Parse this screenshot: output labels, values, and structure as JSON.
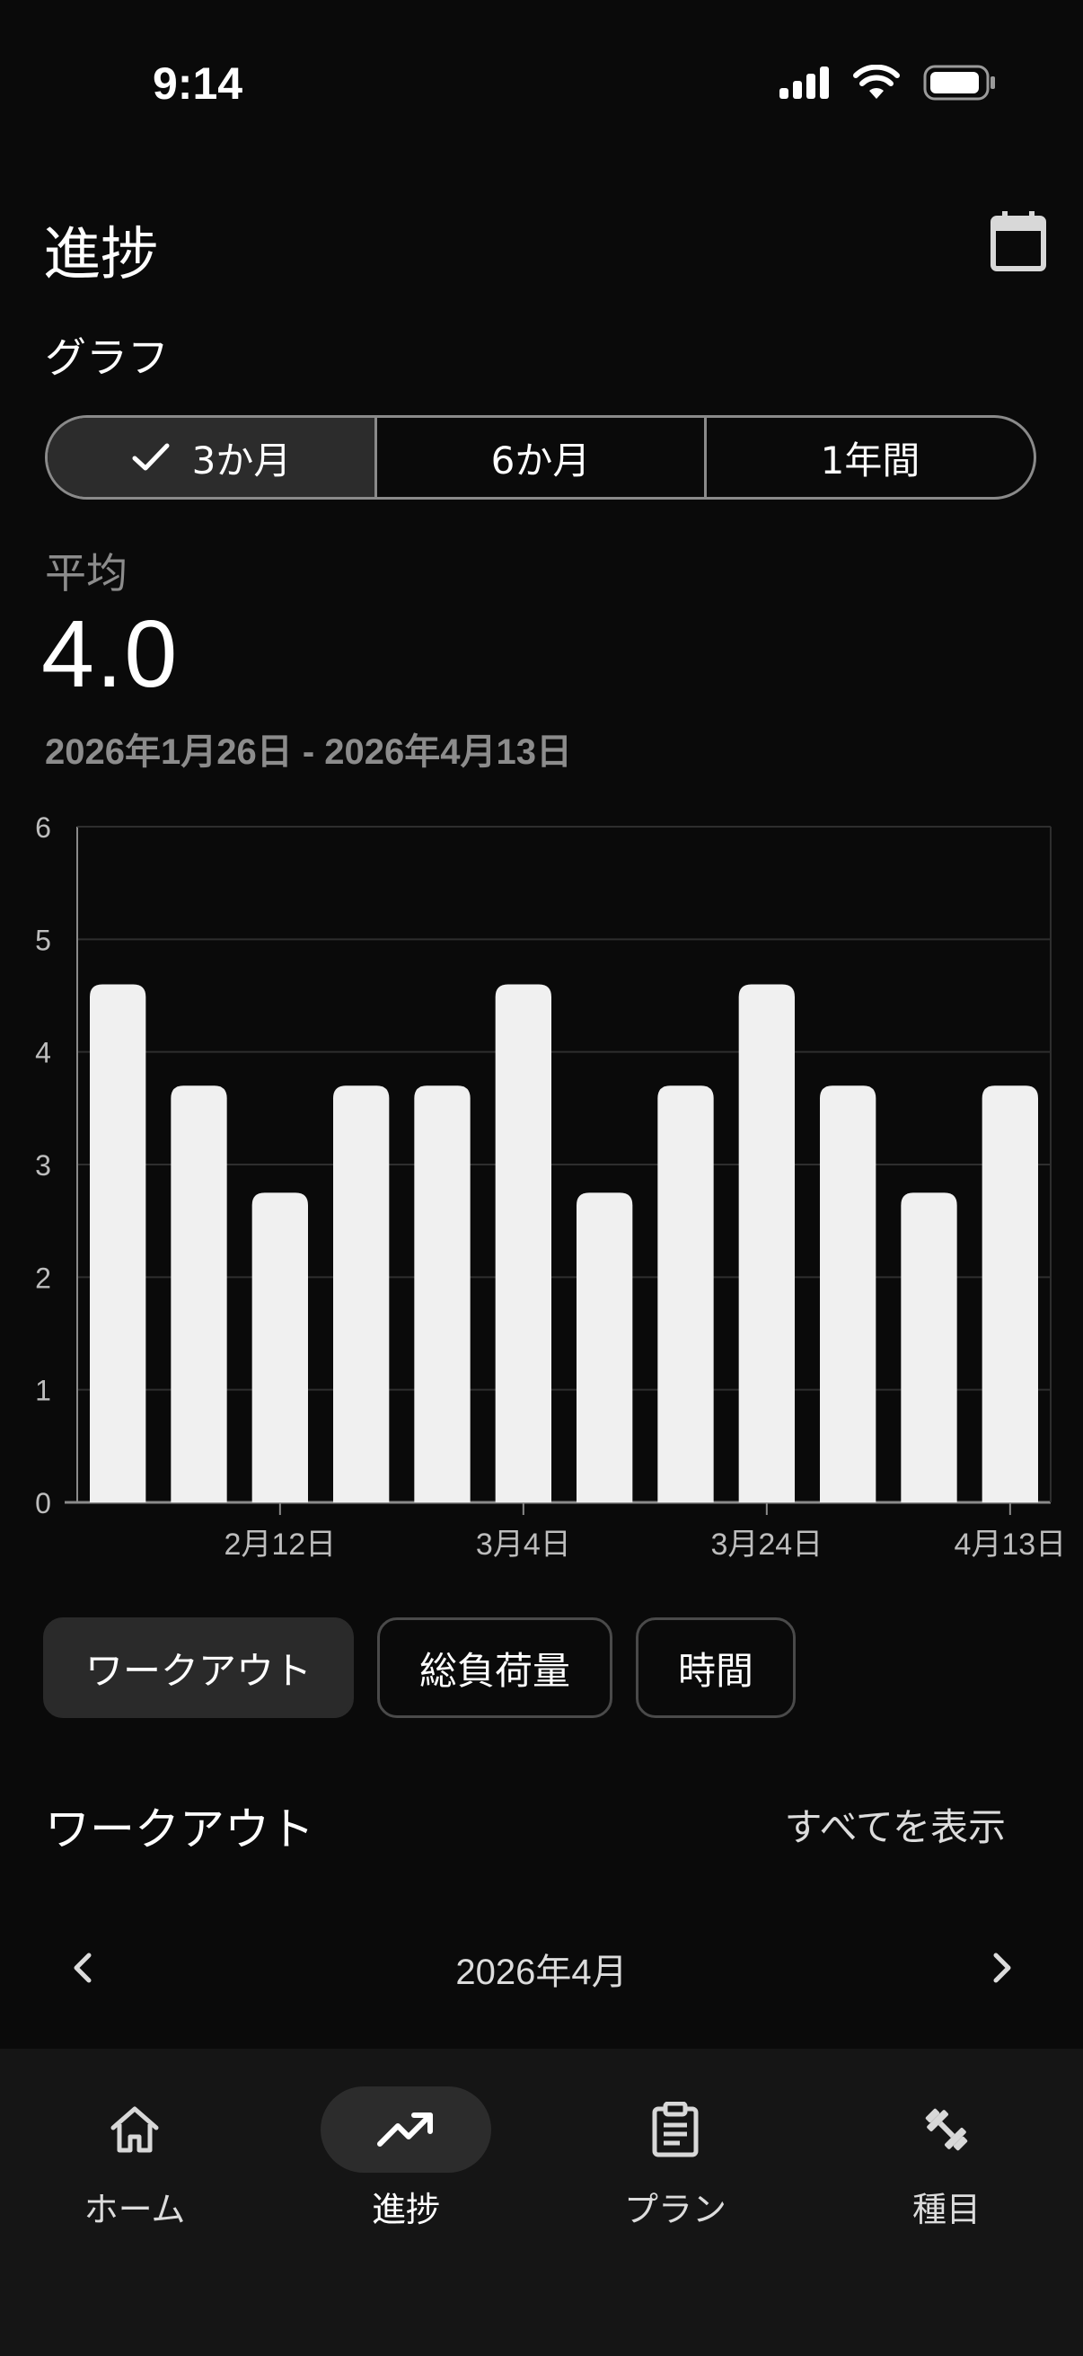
{
  "status_bar": {
    "time": "9:14",
    "icons": [
      "signal-icon",
      "wifi-icon",
      "battery-icon"
    ]
  },
  "header": {
    "title": "進捗",
    "calendar_icon": "calendar-icon"
  },
  "graph_section": {
    "label": "グラフ",
    "ranges": [
      {
        "label": "3か月",
        "selected": true
      },
      {
        "label": "6か月",
        "selected": false
      },
      {
        "label": "1年間",
        "selected": false
      }
    ]
  },
  "summary": {
    "label": "平均",
    "value": "4.0",
    "date_range": "2026年1月26日 - 2026年4月13日"
  },
  "chart_data": {
    "type": "bar",
    "values": [
      4.6,
      3.7,
      2.75,
      3.7,
      3.7,
      4.6,
      2.75,
      3.7,
      4.6,
      3.7,
      2.75,
      3.7
    ],
    "ylim": [
      0,
      6
    ],
    "yticks": [
      "0",
      "1",
      "2",
      "3",
      "4",
      "5",
      "6"
    ],
    "xtick_labels": [
      {
        "index": 2.5,
        "label": "2月12日"
      },
      {
        "index": 5.5,
        "label": "3月4日"
      },
      {
        "index": 8.5,
        "label": "3月24日"
      },
      {
        "index": 11.5,
        "label": "4月13日"
      }
    ],
    "grid": true,
    "bar_color": "#f0f0f0"
  },
  "metric_chips": [
    {
      "label": "ワークアウト",
      "selected": true
    },
    {
      "label": "総負荷量",
      "selected": false
    },
    {
      "label": "時間",
      "selected": false
    }
  ],
  "workouts": {
    "title": "ワークアウト",
    "show_all": "すべてを表示",
    "month": "2026年4月"
  },
  "bottom_nav": [
    {
      "label": "ホーム",
      "icon": "home-icon",
      "active": false
    },
    {
      "label": "進捗",
      "icon": "trending-up-icon",
      "active": true
    },
    {
      "label": "プラン",
      "icon": "clipboard-icon",
      "active": false
    },
    {
      "label": "種目",
      "icon": "dumbbell-icon",
      "active": false
    }
  ],
  "colors": {
    "background": "#0a0a0a",
    "nav_background": "#151515",
    "selected_fill": "#2c2c2c",
    "muted_text": "#8c8c8c"
  }
}
